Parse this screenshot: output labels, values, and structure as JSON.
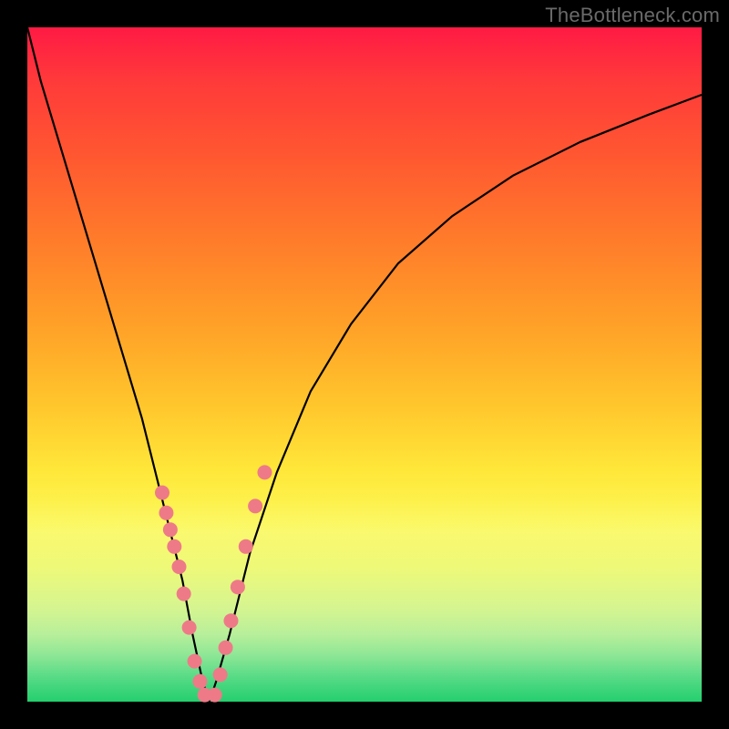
{
  "watermark": {
    "text": "TheBottleneck.com"
  },
  "colors": {
    "frame_bg": "#000000",
    "gradient_top": "#ff1a44",
    "gradient_mid": "#ffe83a",
    "gradient_bottom": "#23cf6e",
    "curve_stroke": "#000000",
    "dot_fill": "#ee7a88",
    "dot_stroke": "#c95a66"
  },
  "chart_data": {
    "type": "line",
    "title": "",
    "xlabel": "",
    "ylabel": "",
    "xlim": [
      0,
      100
    ],
    "ylim": [
      0,
      100
    ],
    "grid": false,
    "legend": false,
    "series": [
      {
        "name": "bottleneck-curve",
        "x": [
          0,
          2,
          5,
          8,
          11,
          14,
          17,
          19,
          21,
          23,
          24.5,
          26,
          27,
          28,
          30,
          33,
          37,
          42,
          48,
          55,
          63,
          72,
          82,
          92,
          100
        ],
        "y": [
          100,
          92,
          82,
          72,
          62,
          52,
          42,
          34,
          26,
          18,
          10,
          3,
          0,
          3,
          10,
          22,
          34,
          46,
          56,
          65,
          72,
          78,
          83,
          87,
          90
        ]
      }
    ],
    "points": [
      {
        "name": "left-arm-dots",
        "x": [
          20.0,
          20.6,
          21.2,
          21.8,
          22.5,
          23.2,
          24.0,
          24.8,
          25.6,
          26.3
        ],
        "y": [
          31,
          28,
          25.5,
          23,
          20,
          16,
          11,
          6,
          3,
          1
        ]
      },
      {
        "name": "right-arm-dots",
        "x": [
          27.8,
          28.6,
          29.4,
          30.2,
          31.2,
          32.4,
          33.8,
          35.2
        ],
        "y": [
          1,
          4,
          8,
          12,
          17,
          23,
          29,
          34
        ]
      }
    ]
  }
}
